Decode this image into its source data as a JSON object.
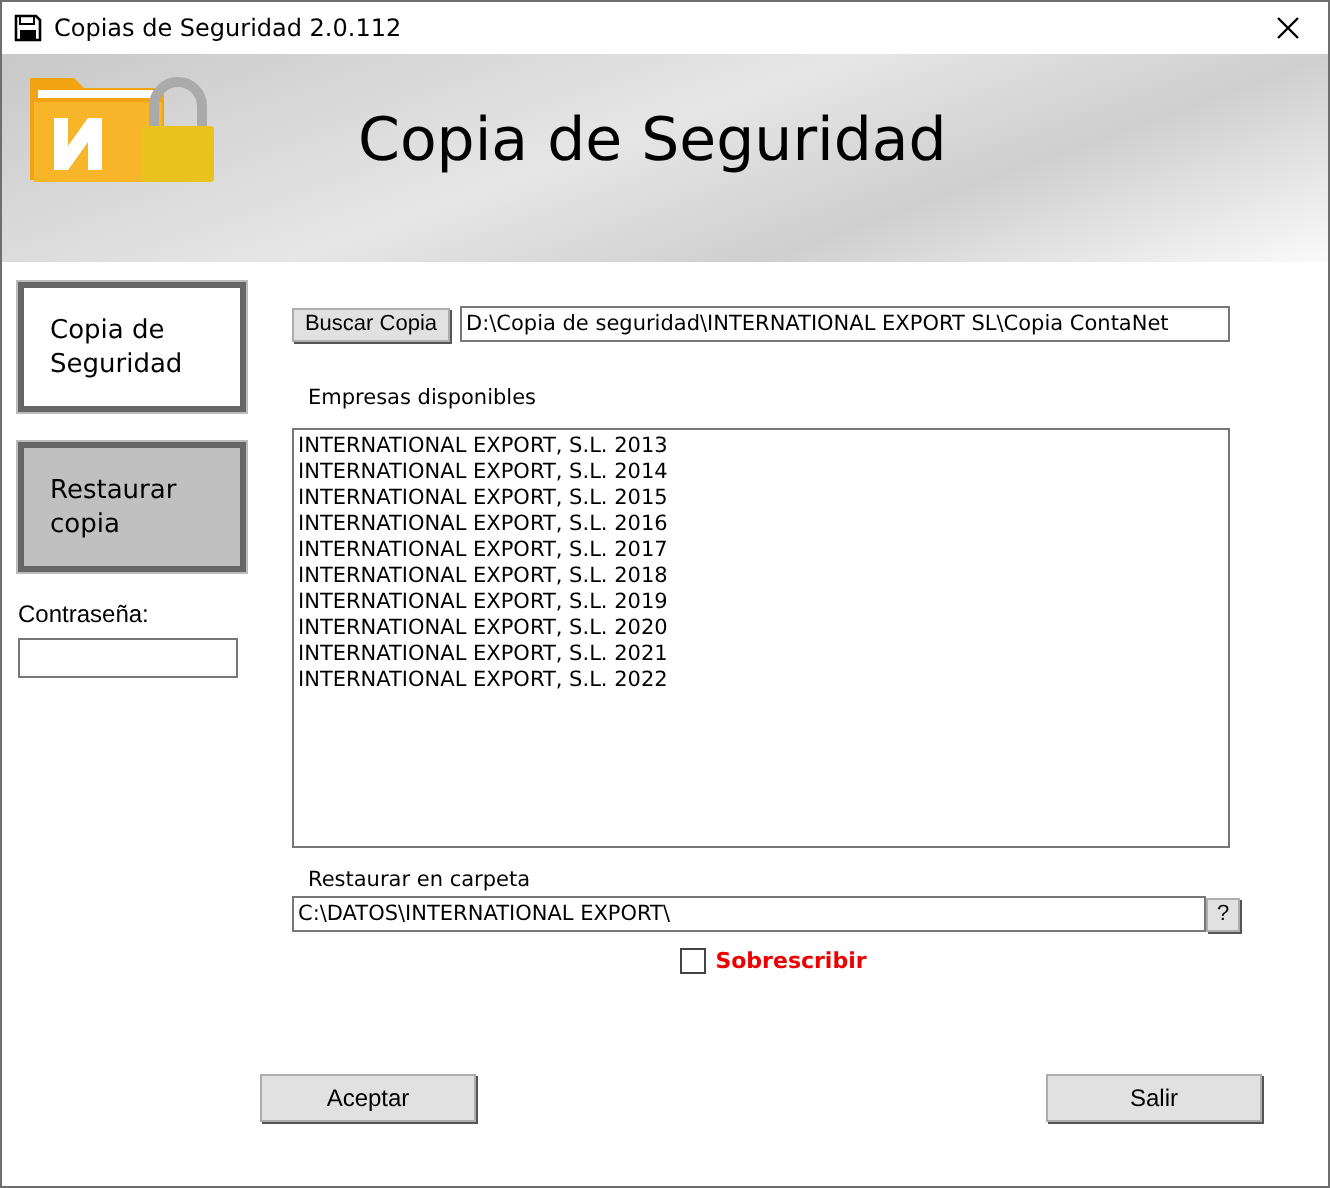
{
  "window": {
    "title": "Copias de Seguridad  2.0.112"
  },
  "header": {
    "title": "Copia de Seguridad"
  },
  "sidebar": {
    "items": [
      {
        "label": "Copia de Seguridad",
        "selected": false
      },
      {
        "label": "Restaurar copia",
        "selected": true
      }
    ],
    "password": {
      "label": "Contraseña:"
    }
  },
  "backup": {
    "button": "Buscar Copia",
    "path": "D:\\Copia de seguridad\\INTERNATIONAL EXPORT SL\\Copia ContaNet"
  },
  "companies": {
    "label": "Empresas disponibles",
    "items": [
      "INTERNATIONAL EXPORT, S.L. 2013",
      "INTERNATIONAL EXPORT, S.L. 2014",
      "INTERNATIONAL EXPORT, S.L. 2015",
      "INTERNATIONAL EXPORT, S.L. 2016",
      "INTERNATIONAL EXPORT, S.L. 2017",
      "INTERNATIONAL EXPORT, S.L. 2018",
      "INTERNATIONAL EXPORT, S.L. 2019",
      "INTERNATIONAL EXPORT, S.L. 2020",
      "INTERNATIONAL EXPORT, S.L. 2021",
      "INTERNATIONAL EXPORT, S.L. 2022"
    ]
  },
  "restore": {
    "label": "Restaurar en carpeta",
    "path": "C:\\DATOS\\INTERNATIONAL EXPORT\\",
    "browse": "?"
  },
  "overwrite": {
    "label": "Sobrescribir",
    "checked": false
  },
  "buttons": [
    "Aceptar",
    "Salir"
  ]
}
